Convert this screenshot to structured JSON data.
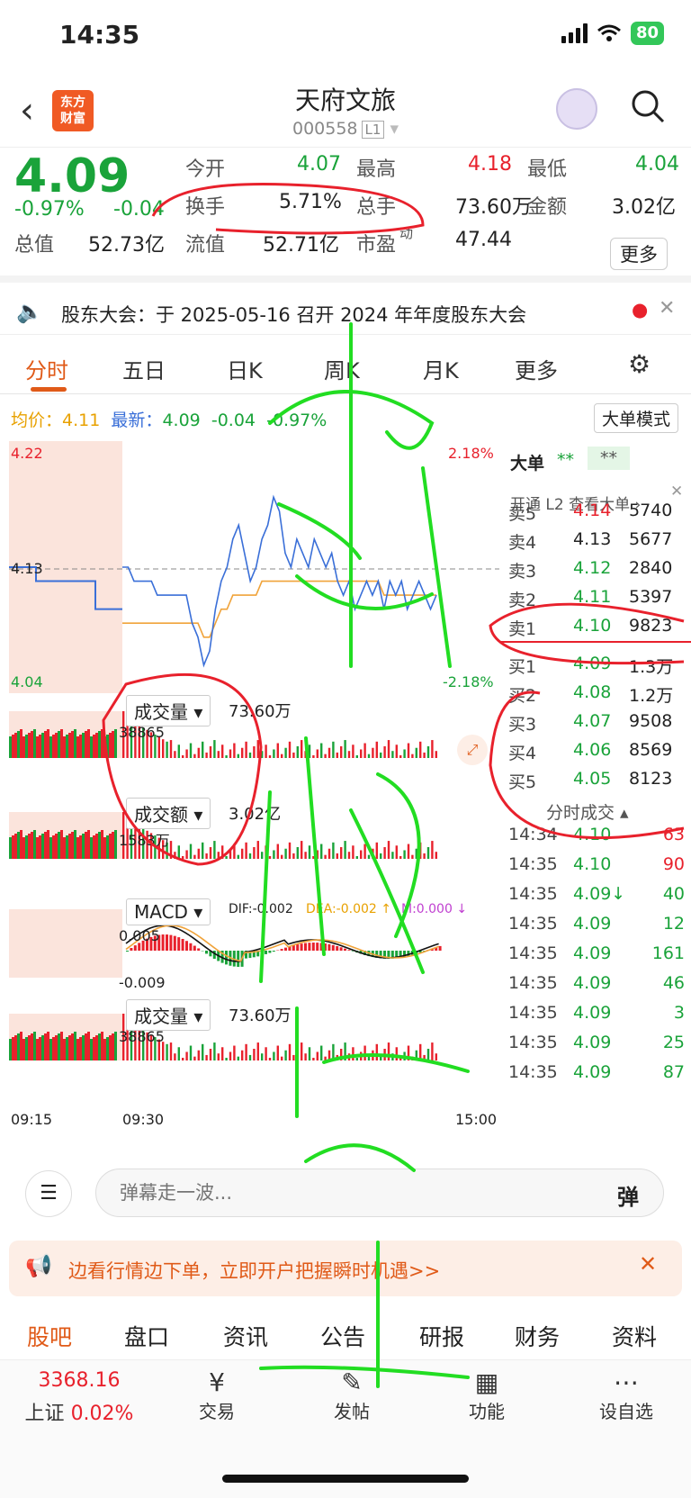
{
  "status": {
    "time": "14:35",
    "battery": "80"
  },
  "header": {
    "title": "天府文旅",
    "code": "000558",
    "level": "L1",
    "logo_line1": "东方",
    "logo_line2": "财富"
  },
  "quote": {
    "price": "4.09",
    "pct": "-0.97%",
    "change": "-0.04",
    "open_label": "今开",
    "open": "4.07",
    "high_label": "最高",
    "high": "4.18",
    "low_label": "最低",
    "low": "4.04",
    "turnover_label": "换手",
    "turnover": "5.71%",
    "volume_label": "总手",
    "volume": "73.60万",
    "amount_label": "金额",
    "amount": "3.02亿",
    "mktcap_label": "总值",
    "mktcap": "52.73亿",
    "float_label": "流值",
    "float": "52.71亿",
    "pe_label": "市盈",
    "pe_sup": "动",
    "pe": "47.44",
    "more": "更多"
  },
  "notice": {
    "text": "股东大会：于 2025-05-16 召开 2024 年年度股东大会"
  },
  "tabs": [
    "分时",
    "五日",
    "日K",
    "周K",
    "月K",
    "更多"
  ],
  "chart_info": {
    "avg_label": "均价：",
    "avg": "4.11",
    "latest_label": "最新：",
    "latest": "4.09",
    "chg": "-0.04",
    "pct": "-0.97%",
    "mode_button": "大单模式"
  },
  "chart_data": {
    "type": "line",
    "title": "",
    "ylim": [
      4.04,
      4.22
    ],
    "yticks": [
      "4.22",
      "4.13",
      "4.04"
    ],
    "pct_top": "2.18%",
    "pct_bottom": "-2.18%",
    "xticks": [
      "09:15",
      "09:30",
      "15:00"
    ],
    "price": [
      4.13,
      4.13,
      4.12,
      4.12,
      4.12,
      4.12,
      4.11,
      4.11,
      4.11,
      4.11,
      4.11,
      4.11,
      4.09,
      4.08,
      4.06,
      4.07,
      4.1,
      4.12,
      4.13,
      4.15,
      4.16,
      4.14,
      4.12,
      4.13,
      4.15,
      4.16,
      4.18,
      4.17,
      4.14,
      4.13,
      4.15,
      4.14,
      4.13,
      4.15,
      4.14,
      4.13,
      4.14,
      4.12,
      4.11,
      4.12,
      4.1,
      4.11,
      4.12,
      4.11,
      4.12,
      4.1,
      4.12,
      4.11,
      4.12,
      4.1,
      4.11,
      4.12,
      4.11,
      4.1,
      4.11
    ],
    "avg_line": [
      4.09,
      4.09,
      4.09,
      4.09,
      4.09,
      4.09,
      4.09,
      4.09,
      4.09,
      4.09,
      4.09,
      4.09,
      4.09,
      4.09,
      4.08,
      4.08,
      4.09,
      4.1,
      4.1,
      4.11,
      4.11,
      4.11,
      4.11,
      4.11,
      4.12,
      4.12,
      4.12,
      4.12,
      4.12,
      4.12,
      4.12,
      4.12,
      4.12,
      4.12,
      4.12,
      4.12,
      4.12,
      4.12,
      4.12,
      4.12,
      4.12,
      4.12,
      4.12,
      4.12,
      4.12,
      4.11,
      4.11,
      4.11,
      4.11,
      4.11,
      4.11,
      4.11,
      4.11,
      4.11,
      4.11
    ],
    "sub1": {
      "name": "成交量",
      "value": "73.60万",
      "peak": "38865"
    },
    "sub2": {
      "name": "成交额",
      "value": "3.02亿",
      "peak": "1583万"
    },
    "sub3": {
      "name": "MACD",
      "dif": "DIF:-0.002",
      "dea": "DEA:-0.002 ↑",
      "macd": "M:0.000 ↓",
      "top": "0.005",
      "bottom": "-0.009"
    },
    "sub4": {
      "name": "成交量",
      "value": "73.60万",
      "peak": "38865"
    }
  },
  "panel": {
    "big": "大单",
    "stars1": "**",
    "stars2": "**",
    "l2": "开通 L2 查看大单 ›",
    "asks": [
      {
        "l": "卖5",
        "p": "4.14",
        "v": "5740",
        "c": "red"
      },
      {
        "l": "卖4",
        "p": "4.13",
        "v": "5677",
        "c": "dark"
      },
      {
        "l": "卖3",
        "p": "4.12",
        "v": "2840",
        "c": "green"
      },
      {
        "l": "卖2",
        "p": "4.11",
        "v": "5397",
        "c": "green"
      },
      {
        "l": "卖1",
        "p": "4.10",
        "v": "9823",
        "c": "green"
      }
    ],
    "bids": [
      {
        "l": "买1",
        "p": "4.09",
        "v": "1.3万",
        "c": "green"
      },
      {
        "l": "买2",
        "p": "4.08",
        "v": "1.2万",
        "c": "green"
      },
      {
        "l": "买3",
        "p": "4.07",
        "v": "9508",
        "c": "green"
      },
      {
        "l": "买4",
        "p": "4.06",
        "v": "8569",
        "c": "green"
      },
      {
        "l": "买5",
        "p": "4.05",
        "v": "8123",
        "c": "green"
      }
    ],
    "ticks_title": "分时成交",
    "ticks": [
      {
        "t": "14:34",
        "p": "4.10",
        "v": "63",
        "c": "red"
      },
      {
        "t": "14:35",
        "p": "4.10",
        "v": "90",
        "c": "red"
      },
      {
        "t": "14:35",
        "p": "4.09↓",
        "v": "40",
        "c": "green"
      },
      {
        "t": "14:35",
        "p": "4.09",
        "v": "12",
        "c": "green"
      },
      {
        "t": "14:35",
        "p": "4.09",
        "v": "161",
        "c": "green"
      },
      {
        "t": "14:35",
        "p": "4.09",
        "v": "46",
        "c": "green"
      },
      {
        "t": "14:35",
        "p": "4.09",
        "v": "3",
        "c": "green"
      },
      {
        "t": "14:35",
        "p": "4.09",
        "v": "25",
        "c": "green"
      },
      {
        "t": "14:35",
        "p": "4.09",
        "v": "87",
        "c": "green"
      }
    ]
  },
  "danmu": {
    "placeholder": "弹幕走一波...",
    "button": "弹"
  },
  "promo": {
    "text": "边看行情边下单，立即开户把握瞬时机遇>>"
  },
  "bottom_tabs": [
    "股吧",
    "盘口",
    "资讯",
    "公告",
    "研报",
    "财务",
    "资料"
  ],
  "nav": {
    "index_value": "3368.16",
    "index_name": "上证",
    "index_pct": "0.02%",
    "items": [
      "交易",
      "发帖",
      "功能",
      "设自选"
    ]
  }
}
